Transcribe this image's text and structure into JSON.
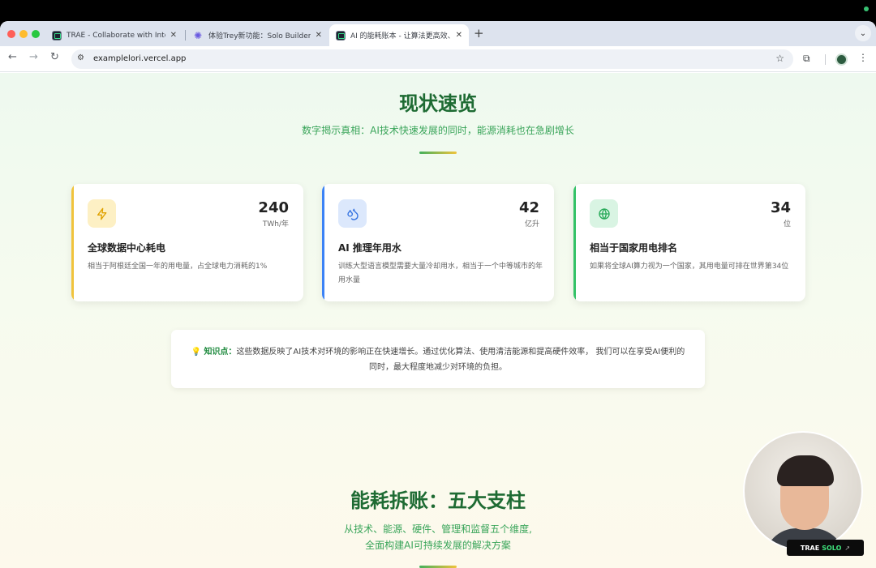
{
  "tabs": [
    {
      "title": "TRAE - Collaborate with Intelli",
      "active": false
    },
    {
      "title": "体验Trey新功能：Solo Builder",
      "active": false
    },
    {
      "title": "AI 的能耗账本 - 让算法更高效、",
      "active": true
    }
  ],
  "address_bar": {
    "url": "examplelori.vercel.app"
  },
  "section1": {
    "title": "现状速览",
    "subtitle": "数字揭示真相：AI技术快速发展的同时，能源消耗也在急剧增长"
  },
  "stats": [
    {
      "value": "240",
      "unit": "TWh/年",
      "title": "全球数据中心耗电",
      "desc": "相当于阿根廷全国一年的用电量，占全球电力消耗的1%",
      "icon": "lightning-icon",
      "color": "#f0c33c"
    },
    {
      "value": "42",
      "unit": "亿升",
      "title": "AI 推理年用水",
      "desc": "训练大型语言模型需要大量冷却用水，相当于一个中等城市的年用水量",
      "icon": "water-drops-icon",
      "color": "#3b82f6"
    },
    {
      "value": "34",
      "unit": "位",
      "title": "相当于国家用电排名",
      "desc": "如果将全球AI算力视为一个国家，其用电量可排在世界第34位",
      "icon": "globe-icon",
      "color": "#34c267"
    }
  ],
  "knowledge": {
    "label": "知识点：",
    "text": "这些数据反映了AI技术对环境的影响正在快速增长。通过优化算法、使用清洁能源和提高硬件效率， 我们可以在享受AI便利的同时，最大程度地减少对环境的负担。"
  },
  "section2": {
    "title": "能耗拆账：五大支柱",
    "subtitle_line1": "从技术、能源、硬件、管理和监督五个维度,",
    "subtitle_line2": "全面构建AI可持续发展的解决方案"
  },
  "overlay": {
    "brand": "TRAE",
    "solo": "SOLO"
  }
}
